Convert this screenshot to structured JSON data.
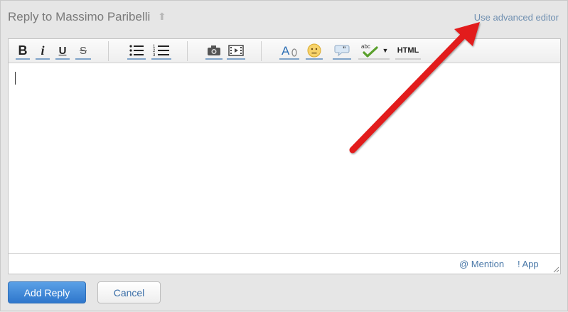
{
  "title": "Reply to Massimo Paribelli",
  "advanced_editor_link": "Use advanced editor",
  "toolbar": {
    "bold": "B",
    "italic": "i",
    "underline": "U",
    "strike": "S",
    "html": "HTML"
  },
  "footer": {
    "mention": "@ Mention",
    "app": "! App"
  },
  "buttons": {
    "add_reply": "Add Reply",
    "cancel": "Cancel"
  },
  "colors": {
    "accent": "#2f77cc",
    "arrow": "#e21b1b"
  }
}
